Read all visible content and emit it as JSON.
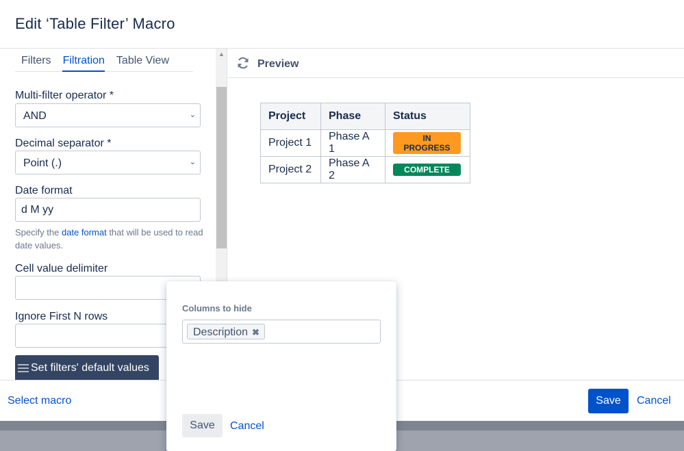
{
  "dialog": {
    "title": "Edit ‘Table Filter’ Macro"
  },
  "tabs": [
    {
      "label": "Filters",
      "active": false
    },
    {
      "label": "Filtration",
      "active": true
    },
    {
      "label": "Table View",
      "active": false
    }
  ],
  "form": {
    "multi_filter_label": "Multi-filter operator *",
    "multi_filter_value": "AND",
    "decimal_label": "Decimal separator *",
    "decimal_value": "Point (.)",
    "date_format_label": "Date format",
    "date_format_value": "d M yy",
    "date_help_prefix": "Specify the ",
    "date_help_link": "date format",
    "date_help_suffix": " that will be used to read date values.",
    "cell_delimiter_label": "Cell value delimiter",
    "cell_delimiter_value": "",
    "ignore_rows_label": "Ignore First N rows",
    "ignore_rows_value": "",
    "default_values_button": "Set filters' default values"
  },
  "preview": {
    "label": "Preview",
    "icon": "refresh-icon",
    "table": {
      "headers": [
        "Project",
        "Phase",
        "Status"
      ],
      "rows": [
        [
          "Project 1",
          "Phase A 1",
          "IN PROGRESS"
        ],
        [
          "Project 2",
          "Phase A 2",
          "COMPLETE"
        ]
      ]
    },
    "status_colors": {
      "in_progress": "#ff991f",
      "complete": "#00875a"
    }
  },
  "footer": {
    "select_macro": "Select macro",
    "save": "Save",
    "cancel": "Cancel"
  },
  "popup": {
    "columns_label": "Columns to hide",
    "tag": "Description",
    "save": "Save",
    "cancel": "Cancel"
  },
  "colors": {
    "accent": "#0052cc",
    "dark_button": "#344563",
    "text": "#172b4d"
  }
}
